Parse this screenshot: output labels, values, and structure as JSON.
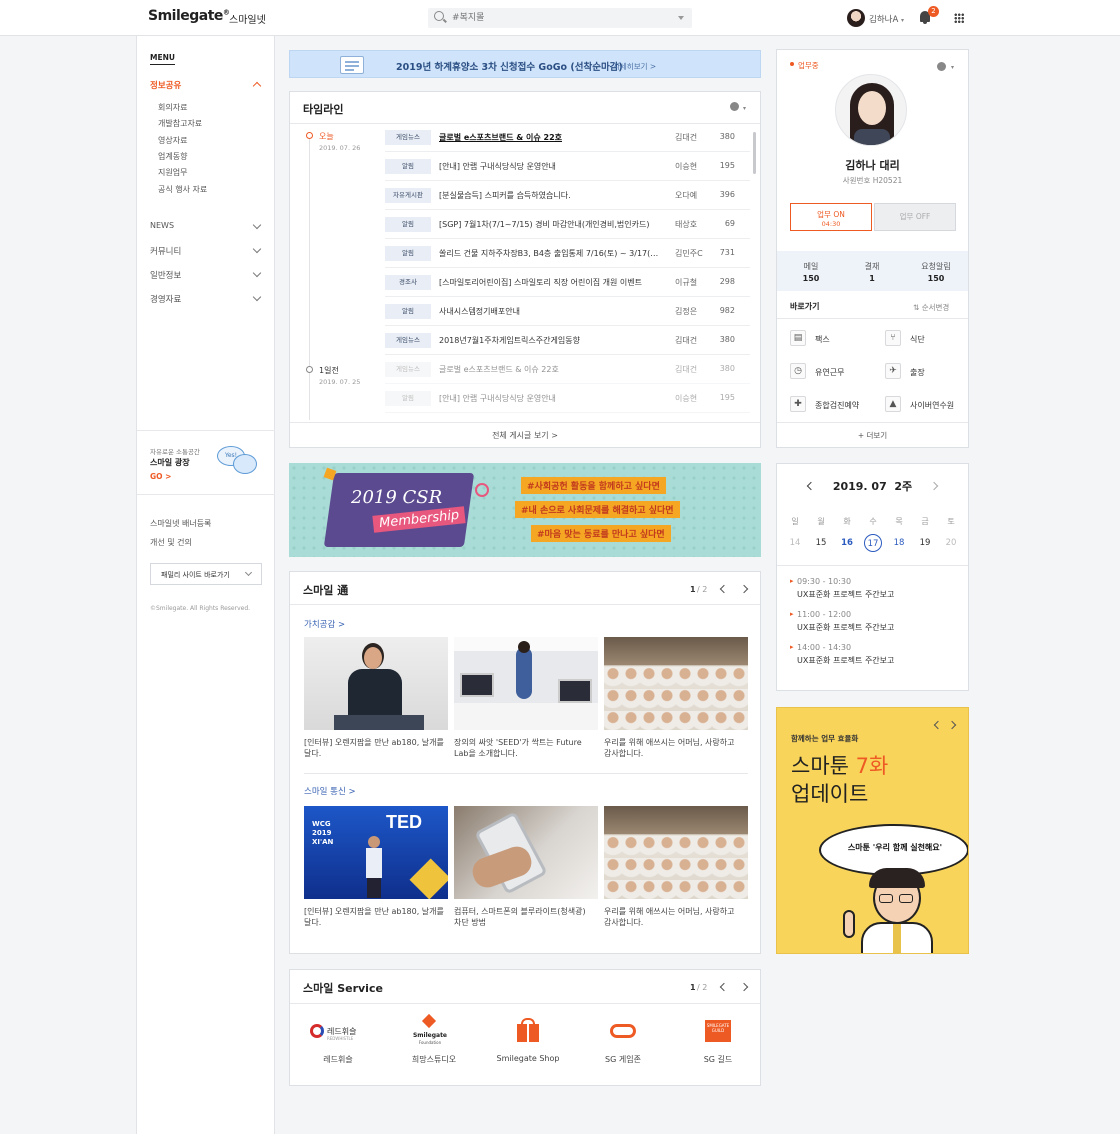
{
  "header": {
    "logo": "Smilegate",
    "logo_mark": "®",
    "logo_sub": "스마일넷",
    "search_placeholder": "#복지몰",
    "user_name": "김하나A",
    "notification_count": "2"
  },
  "sidebar": {
    "menu_title": "MENU",
    "active_section": "정보공유",
    "sub_items": [
      "회의자료",
      "개발참고자료",
      "영상자료",
      "업계동향",
      "지원업무",
      "공식 행사 자료"
    ],
    "sections": [
      "NEWS",
      "커뮤니티",
      "일반정보",
      "경영자료"
    ],
    "promo_small": "자유로운 소통공간",
    "promo_title": "스마일 광장",
    "promo_go": "GO >",
    "promo_bubble": "Yes!",
    "links": [
      "스마일넷 배너등록",
      "개선 및 건의"
    ],
    "family_site": "패밀리 사이트 바로가기",
    "copyright": "©Smilegate. All Rights Reserved."
  },
  "notice_banner": {
    "text": "2019년 하계휴양소 3차 신청접수 GoGo (선착순마감)",
    "more": "자세히보기 >"
  },
  "timeline": {
    "title": "타임라인",
    "dates": [
      {
        "label": "오늘",
        "date": "2019. 07. 26"
      },
      {
        "label": "1일전",
        "date": "2019. 07. 25"
      }
    ],
    "rows": [
      {
        "cat": "게임뉴스",
        "title": "글로벌 e스포츠브랜드 & 이슈 22호",
        "author": "김대건",
        "count": "380",
        "bold": true
      },
      {
        "cat": "알림",
        "title": "[안내] 안랩 구내식당식당 운영안내",
        "author": "이승현",
        "count": "195"
      },
      {
        "cat": "자유게시판",
        "title": "[분실물습득] 스피커를 습득하였습니다.",
        "author": "오다예",
        "count": "396"
      },
      {
        "cat": "알림",
        "title": "[SGP] 7월1차(7/1~7/15) 경비 마감안내(개인경비,법인카드)",
        "author": "태상호",
        "count": "69"
      },
      {
        "cat": "알림",
        "title": "쏠리드 건물 지하주차장B3, B4층 출입통제 7/16(토) ~ 3/17(일)",
        "author": "김민주C",
        "count": "731"
      },
      {
        "cat": "경조사",
        "title": "[스마일토리어린이집] 스마일토리 직장 어린이집 개원 이벤트",
        "author": "이규철",
        "count": "298"
      },
      {
        "cat": "알림",
        "title": "사내시스템정기배포안내",
        "author": "김정은",
        "count": "982"
      },
      {
        "cat": "게임뉴스",
        "title": "2018년7월1주차게임트릭스주간게임동향",
        "author": "김대건",
        "count": "380"
      },
      {
        "cat": "게임뉴스",
        "title": "글로벌 e스포츠브랜드 & 이슈 22호",
        "author": "김대건",
        "count": "380",
        "faded": true
      },
      {
        "cat": "알림",
        "title": "[안내] 안랩 구내식당식당 운영안내",
        "author": "이승현",
        "count": "195",
        "faded": true
      }
    ],
    "view_all": "전체 게시글 보기 >"
  },
  "csr_banner": {
    "title_1": "2019 CSR",
    "title_2": "Membership",
    "tags": [
      "#사회공헌 활동을 함께하고 싶다면",
      "#내 손으로 사회문제를 해결하고 싶다면",
      "#마음 맞는 동료를 만나고 싶다면"
    ]
  },
  "smile_tong": {
    "title": "스마일 通",
    "page": "1",
    "pages": "/ 2",
    "sections": [
      {
        "label": "가치공감 >",
        "captions": [
          "[인터뷰] 오렌지팜을 만난 ab180, 날개를 달다.",
          "장의의 싸앗 'SEED'가 싹트는 Future Lab을 소개합니다.",
          "우리를 위해 애쓰시는 어머님, 사랑하고 감사합니다."
        ]
      },
      {
        "label": "스마일 통신 >",
        "captions": [
          "[인터뷰] 오렌지팜을 만난 ab180, 날개를 달다.",
          "컴퓨터, 스마트폰의 블루라이트(청색광) 차단 방법",
          "우리를 위해 애쓰시는 어머님, 사랑하고 감사합니다."
        ]
      }
    ],
    "ted_text": "TED",
    "wcg_text": "WCG 2019 XI'AN"
  },
  "smile_service": {
    "title": "스마일 Service",
    "page": "1",
    "pages": "/ 2",
    "items": [
      {
        "label": "레드휘슬",
        "logo_text": "레드휘슬",
        "logo_sub": "REDWHISTLE"
      },
      {
        "label": "희망스튜디오",
        "logo_text": "Smilegate",
        "logo_sub": "Foundation"
      },
      {
        "label": "Smilegate Shop"
      },
      {
        "label": "SG 게임존"
      },
      {
        "label": "SG 길드",
        "logo_text": "SMILEGATE GUILD"
      }
    ]
  },
  "profile": {
    "status": "업무중",
    "name": "김하나 대리",
    "emp_no": "사원번호 H20521",
    "work_on": "업무 ON",
    "work_on_time": "04:30",
    "work_off": "업무 OFF",
    "stats": [
      {
        "label": "메일",
        "value": "150"
      },
      {
        "label": "결재",
        "value": "1"
      },
      {
        "label": "요청알림",
        "value": "150"
      }
    ],
    "shortcuts_title": "바로가기",
    "reorder": "순서변경",
    "shortcuts": [
      "팩스",
      "식단",
      "유연근무",
      "출장",
      "종합검진예약",
      "사이버연수원"
    ],
    "more": "+ 더보기"
  },
  "calendar": {
    "title": "2019. 07  2주",
    "weekdays": [
      "일",
      "월",
      "화",
      "수",
      "목",
      "금",
      "토"
    ],
    "days": [
      "14",
      "15",
      "16",
      "17",
      "18",
      "19",
      "20"
    ],
    "events": [
      {
        "time": "09:30 - 10:30",
        "name": "UX표준화 프로젝트 주간보고"
      },
      {
        "time": "11:00 - 12:00",
        "name": "UX표준화 프로젝트 주간보고"
      },
      {
        "time": "14:00 - 14:30",
        "name": "UX표준화 프로젝트 주간보고"
      }
    ]
  },
  "promo_card": {
    "small": "함께하는 업무 효율화",
    "line1_a": "스마툰 ",
    "line1_b": "7화",
    "line2": "업데이트",
    "bubble": "스마툰 '우리 함께 실천해요'"
  },
  "colors": {
    "accent": "#ee5a24",
    "link_blue": "#3b64b4",
    "promo_yellow": "#f9d45a",
    "csr_teal": "#a9dcd6"
  }
}
